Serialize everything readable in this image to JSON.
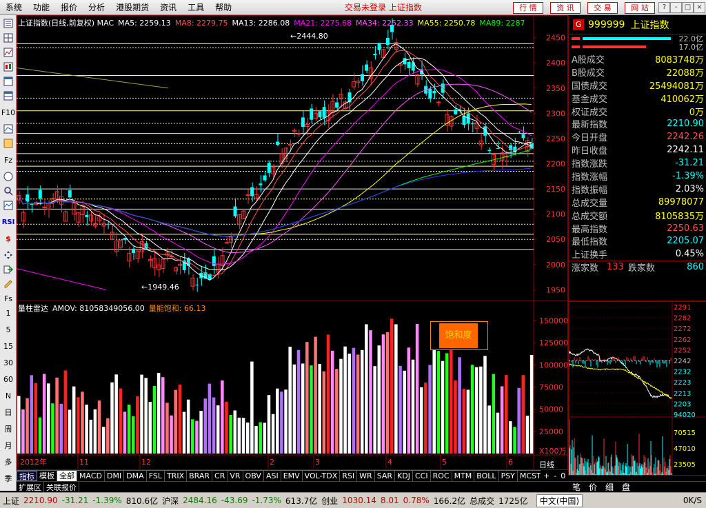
{
  "menu": {
    "items": [
      "系统",
      "功能",
      "报价",
      "分析",
      "港股期货",
      "资讯",
      "工具",
      "帮助"
    ],
    "title": "交易未登录 上证指数",
    "nav_buttons": [
      "行 情",
      "资 讯",
      "交 易",
      "网 站"
    ],
    "window_controls": [
      "?",
      "-",
      "□",
      "×"
    ]
  },
  "toolbar": {
    "icons": [
      "list-icon",
      "grid-icon",
      "line-chart-icon",
      "candle-icon",
      "table-icon",
      "table-icon",
      "f10-icon",
      "chart-icon",
      "info-icon",
      "fz-icon",
      "f10-icon",
      "search-icon",
      "chart-icon",
      "rsi-icon",
      "dollar-icon",
      "move-icon",
      "arrow-icon",
      "pencil-icon"
    ],
    "labels": {
      "f10": "F10",
      "fz": "Fz",
      "rsi": "RSI",
      "fs": "Fs"
    },
    "periods": [
      "1",
      "5",
      "15",
      "30",
      "60",
      "N",
      "日",
      "周",
      "月",
      "多",
      "季",
      "年"
    ]
  },
  "main": {
    "indicator_line": [
      {
        "text": "上证指数(日线,前复权) MAC",
        "color": "#ffffff"
      },
      {
        "text": "MA5: 2259.13",
        "color": "#ffffff"
      },
      {
        "text": "MA8: 2279.75",
        "color": "#ff5050"
      },
      {
        "text": "MA13: 2286.08",
        "color": "#ffffff"
      },
      {
        "text": "MA21: 2275.68",
        "color": "#ff00ff"
      },
      {
        "text": "MA34: 2252.33",
        "color": "#ff55ff"
      },
      {
        "text": "MA55: 2250.78",
        "color": "#ffff00"
      },
      {
        "text": "MA89: 2287",
        "color": "#00ff00"
      }
    ],
    "high_label": "2444.80",
    "low_label": "1949.46",
    "price_axis": [
      "2450",
      "2400",
      "2350",
      "2300",
      "2250",
      "2200",
      "2150",
      "2100",
      "2050",
      "2000",
      "1950"
    ],
    "vol_line": [
      {
        "text": "量柱雷达",
        "color": "#ffffff"
      },
      {
        "text": "AMOV: 81058349056.00",
        "color": "#ffffff"
      },
      {
        "text": "量能饱和: 66.13",
        "color": "#ff8800"
      }
    ],
    "vol_axis": [
      "150000",
      "125000",
      "100000",
      "75000",
      "50000",
      "25000",
      "X100万"
    ],
    "date_axis": [
      "2012年",
      "11",
      "12",
      "2",
      "3",
      "4",
      "5",
      "6"
    ],
    "saturation_button": "饱和度",
    "period_label": "日线"
  },
  "quote_panel": {
    "code": "999999",
    "name": "上证指数",
    "bar1_label": "22.0亿",
    "bar2_label": "17.0亿",
    "rows": [
      {
        "key": "A股成交",
        "value": "8083748万",
        "color": "#ffff00"
      },
      {
        "key": "B股成交",
        "value": "22088万",
        "color": "#ffff00"
      },
      {
        "key": "国债成交",
        "value": "25494081万",
        "color": "#ffff00"
      },
      {
        "key": "基金成交",
        "value": "410062万",
        "color": "#ffff00"
      },
      {
        "key": "权证成交",
        "value": "0万",
        "color": "#ffff00"
      },
      {
        "key": "最新指数",
        "value": "2210.90",
        "color": "#00ffff"
      },
      {
        "key": "今日开盘",
        "value": "2242.26",
        "color": "#ff5050"
      },
      {
        "key": "昨日收盘",
        "value": "2242.11",
        "color": "#ffffff"
      },
      {
        "key": "指数涨跌",
        "value": "-31.21",
        "color": "#00ffff"
      },
      {
        "key": "指数涨幅",
        "value": "-1.39%",
        "color": "#00ffff"
      },
      {
        "key": "指数振幅",
        "value": "2.03%",
        "color": "#ffffff"
      },
      {
        "key": "总成交量",
        "value": "89978077",
        "color": "#ffff00"
      },
      {
        "key": "总成交额",
        "value": "8105835万",
        "color": "#ffff00"
      },
      {
        "key": "最高指数",
        "value": "2250.63",
        "color": "#ff5050"
      },
      {
        "key": "最低指数",
        "value": "2205.07",
        "color": "#00ffff"
      },
      {
        "key": "上证换手",
        "value": "0.45%",
        "color": "#ffffff"
      }
    ],
    "up_label": "涨家数",
    "up_value": "133",
    "down_label": "跌家数",
    "down_value": "860"
  },
  "mini_chart": {
    "price_axis": [
      "2291",
      "2282",
      "2272",
      "2262",
      "2252",
      "2242",
      "2232",
      "2223",
      "2213",
      "2203",
      "94020"
    ],
    "vol_axis": [
      "70515",
      "47010",
      "23505"
    ],
    "tabs": [
      "笔",
      "价",
      "细",
      "盘"
    ],
    "speed": "0K/S"
  },
  "bottom_tabs": [
    "指标",
    "模板",
    "全部",
    "MACD",
    "DMI",
    "DMA",
    "FSL",
    "TRIX",
    "BRAR",
    "CR",
    "VR",
    "OBV",
    "ASI",
    "EMV",
    "VOL-TDX",
    "RSI",
    "WR",
    "SAR",
    "KDJ",
    "CCI",
    "ROC",
    "MTM",
    "BOLL",
    "PSY",
    "MCST"
  ],
  "ext_tabs": [
    "扩展区",
    "关联报价"
  ],
  "statusbar": [
    {
      "text": "上证",
      "cls": ""
    },
    {
      "text": "2210.90",
      "cls": "sb-red"
    },
    {
      "text": "-31.21",
      "cls": "sb-green"
    },
    {
      "text": "-1.39%",
      "cls": "sb-green"
    },
    {
      "text": "810.6亿",
      "cls": ""
    },
    {
      "text": "沪深",
      "cls": ""
    },
    {
      "text": "2484.16",
      "cls": "sb-green"
    },
    {
      "text": "-43.69",
      "cls": "sb-green"
    },
    {
      "text": "-1.73%",
      "cls": "sb-green"
    },
    {
      "text": "613.7亿",
      "cls": ""
    },
    {
      "text": "创业",
      "cls": ""
    },
    {
      "text": "1030.14",
      "cls": "sb-red"
    },
    {
      "text": "8.01",
      "cls": "sb-red"
    },
    {
      "text": "0.78%",
      "cls": "sb-red"
    },
    {
      "text": "166.2亿",
      "cls": ""
    },
    {
      "text": "总成交",
      "cls": ""
    },
    {
      "text": "1725亿",
      "cls": ""
    },
    {
      "text": "中文(中国)",
      "cls": ""
    }
  ]
}
